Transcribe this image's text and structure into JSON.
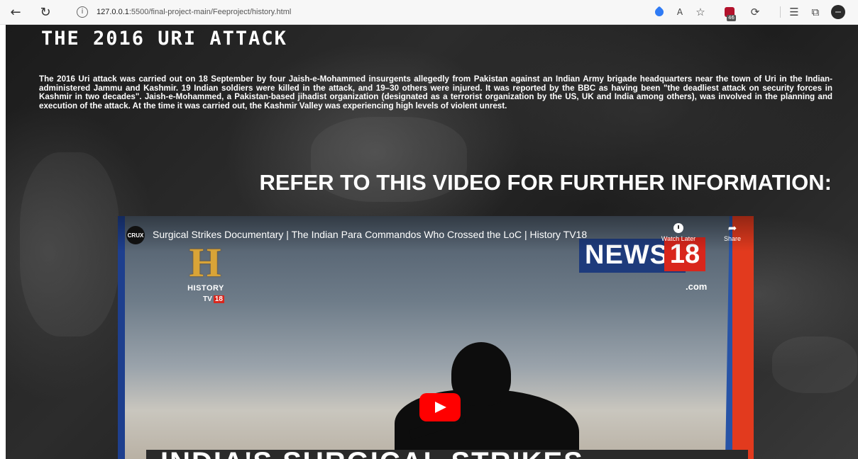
{
  "browser": {
    "back_icon": "arrow-left-icon",
    "refresh_icon": "refresh-icon",
    "url_host": "127.0.0.1",
    "url_path": ":5500/final-project-main/Feeproject/history.html",
    "read_aloud_label": "A",
    "extension_badge": "46",
    "toolbar_icons": [
      "tag-icon",
      "read-aloud-icon",
      "favorite-icon",
      "extension-icon",
      "sync-icon",
      "favorites-list-icon",
      "collections-icon",
      "profile-avatar"
    ]
  },
  "page": {
    "heading": "THE 2016 URI ATTACK",
    "body": "The 2016 Uri attack was carried out on 18 September by four Jaish-e-Mohammed insurgents allegedly from Pakistan against an Indian Army brigade headquarters near the town of Uri in the Indian-administered Jammu and Kashmir. 19 Indian soldiers were killed in the attack, and 19–30 others were injured. It was reported by the BBC as having been \"the deadliest attack on security forces in Kashmir in two decades\". Jaish-e-Mohammed, a Pakistan-based jihadist organization (designated as a terrorist organization by the US, UK and India among others), was involved in the planning and execution of the attack. At the time it was carried out, the Kashmir Valley was experiencing high levels of violent unrest.",
    "video_heading": "REFER TO THIS VIDEO FOR FURTHER INFORMATION:"
  },
  "video": {
    "channel_label": "CRUX",
    "title": "Surgical Strikes Documentary | The Indian Para Commandos Who Crossed the LoC | History TV18",
    "watch_later": "Watch Later",
    "share": "Share",
    "news_word": "NEWS",
    "news_number": "18",
    "news_domain": ".com",
    "history_letter": "H",
    "history_brand": "HISTORY",
    "history_tv": "TV",
    "history_tv_num": "18",
    "overlay_text": "INDIA'S SURGICAL STRIKES"
  },
  "colors": {
    "youtube_red": "#ff0000",
    "news18_blue": "#1e3b7c",
    "news18_red": "#d9261c",
    "history_gold": "#d9a437"
  }
}
